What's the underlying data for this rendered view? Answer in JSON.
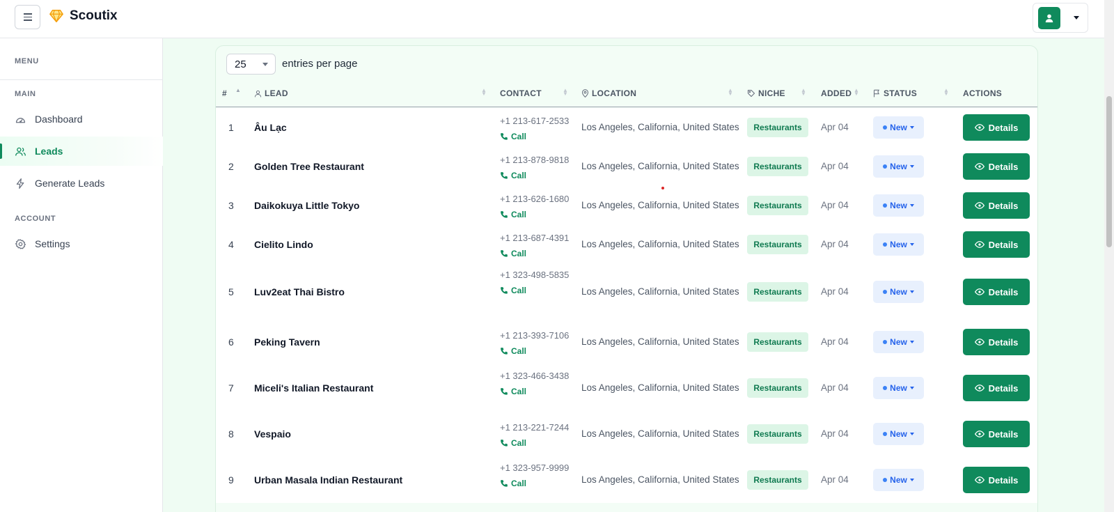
{
  "app": {
    "name": "Scoutix"
  },
  "sidebar": {
    "menu_heading": "MENU",
    "main_heading": "MAIN",
    "account_heading": "ACCOUNT",
    "items": [
      {
        "label": "Dashboard",
        "icon": "gauge-icon",
        "active": false
      },
      {
        "label": "Leads",
        "icon": "users-icon",
        "active": true
      },
      {
        "label": "Generate Leads",
        "icon": "bolt-icon",
        "active": false
      },
      {
        "label": "Settings",
        "icon": "gear-icon",
        "active": false
      }
    ]
  },
  "table_controls": {
    "entries_value": "25",
    "entries_label": "entries per page"
  },
  "table": {
    "columns": [
      "#",
      "LEAD",
      "CONTACT",
      "LOCATION",
      "NICHE",
      "ADDED",
      "STATUS",
      "ACTIONS"
    ],
    "call_label": "Call",
    "details_label": "Details",
    "rows": [
      {
        "num": "1",
        "lead": "Âu Lạc",
        "phone": "+1 213-617-2533",
        "location": "Los Angeles, California, United States",
        "niche": "Restaurants",
        "added": "Apr 04",
        "status": "New"
      },
      {
        "num": "2",
        "lead": "Golden Tree Restaurant",
        "phone": "+1 213-878-9818",
        "location": "Los Angeles, California, United States",
        "niche": "Restaurants",
        "added": "Apr 04",
        "status": "New"
      },
      {
        "num": "3",
        "lead": "Daikokuya Little Tokyo",
        "phone": "+1 213-626-1680",
        "location": "Los Angeles, California, United States",
        "niche": "Restaurants",
        "added": "Apr 04",
        "status": "New"
      },
      {
        "num": "4",
        "lead": "Cielito Lindo",
        "phone": "+1 213-687-4391",
        "location": "Los Angeles, California, United States",
        "niche": "Restaurants",
        "added": "Apr 04",
        "status": "New"
      },
      {
        "num": "5",
        "lead": "Luv2eat Thai Bistro",
        "phone": "+1 323-498-5835",
        "location": "Los Angeles, California, United States",
        "niche": "Restaurants",
        "added": "Apr 04",
        "status": "New"
      },
      {
        "num": "6",
        "lead": "Peking Tavern",
        "phone": "+1 213-393-7106",
        "location": "Los Angeles, California, United States",
        "niche": "Restaurants",
        "added": "Apr 04",
        "status": "New"
      },
      {
        "num": "7",
        "lead": "Miceli's Italian Restaurant",
        "phone": "+1 323-466-3438",
        "location": "Los Angeles, California, United States",
        "niche": "Restaurants",
        "added": "Apr 04",
        "status": "New"
      },
      {
        "num": "8",
        "lead": "Vespaio",
        "phone": "+1 213-221-7244",
        "location": "Los Angeles, California, United States",
        "niche": "Restaurants",
        "added": "Apr 04",
        "status": "New"
      },
      {
        "num": "9",
        "lead": "Urban Masala Indian Restaurant",
        "phone": "+1 323-957-9999",
        "location": "Los Angeles, California, United States",
        "niche": "Restaurants",
        "added": "Apr 04",
        "status": "New"
      }
    ]
  },
  "colors": {
    "brand": "#0f8a5c",
    "accent_bg": "#effcf3",
    "status": "#2563eb"
  }
}
